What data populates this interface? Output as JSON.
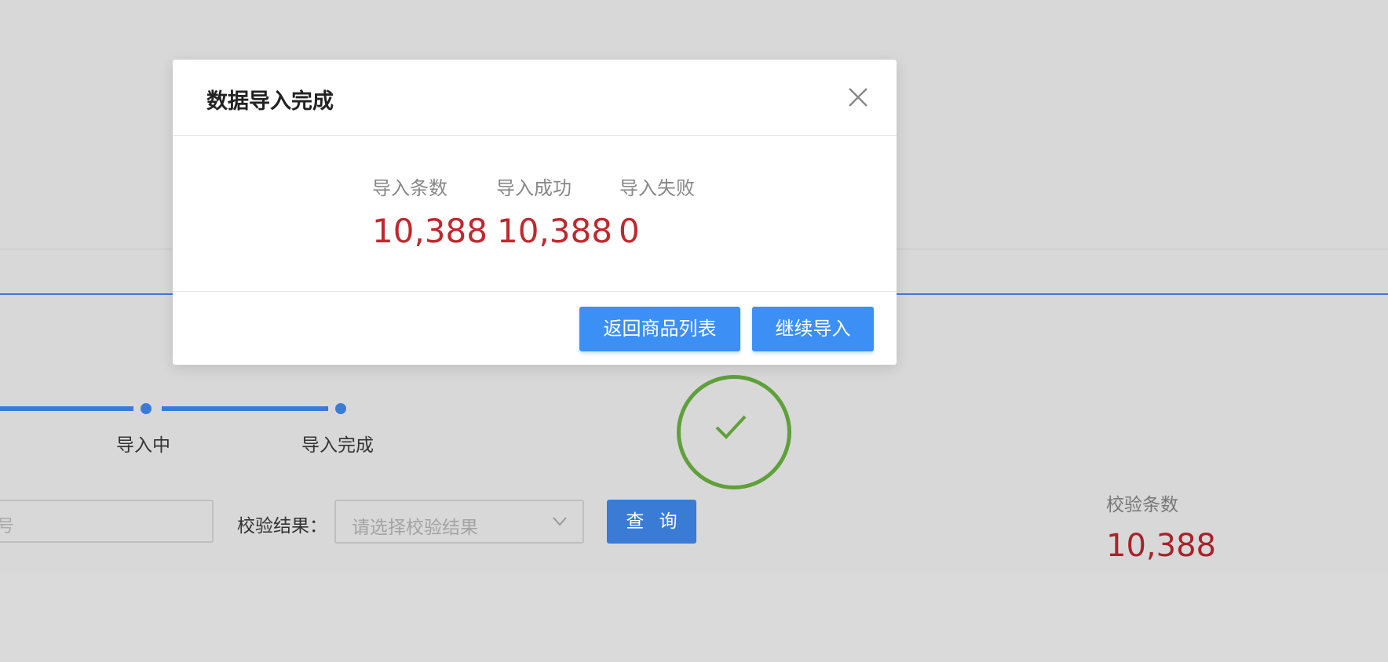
{
  "background": {
    "steps": [
      {
        "label": "导入中"
      },
      {
        "label": "导入完成"
      }
    ],
    "filter": {
      "input_partial_placeholder": "号",
      "result_label": "校验结果：",
      "result_placeholder": "请选择校验结果",
      "query_label": "查 询"
    },
    "stat": {
      "label": "校验条数",
      "value": "10,388"
    },
    "colors": {
      "accent": "#3a7bd5",
      "success": "#5fa03a",
      "stat_red": "#a8232a"
    }
  },
  "modal": {
    "title": "数据导入完成",
    "close_icon": "close-icon",
    "stats": [
      {
        "label": "导入条数",
        "value": "10,388"
      },
      {
        "label": "导入成功",
        "value": "10,388"
      },
      {
        "label": "导入失败",
        "value": "0"
      }
    ],
    "buttons": {
      "back_label": "返回商品列表",
      "continue_label": "继续导入"
    },
    "colors": {
      "value_red": "#c0282d",
      "button_blue": "#3b8ff5"
    }
  }
}
